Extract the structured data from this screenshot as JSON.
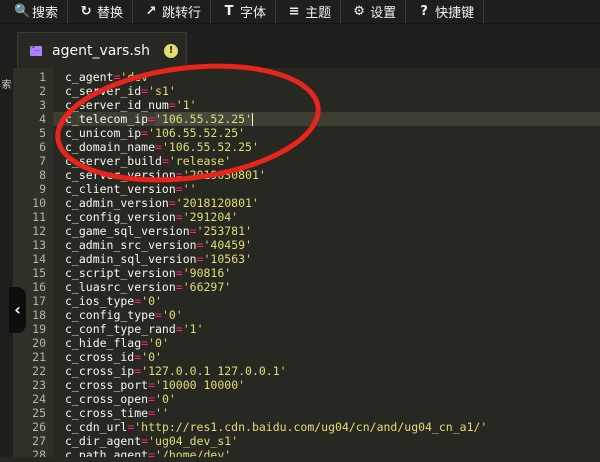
{
  "toolbar": {
    "buttons": [
      {
        "icon": "search-icon",
        "glyph": "🔍",
        "label": "搜索"
      },
      {
        "icon": "replace-icon",
        "glyph": "↻",
        "label": "替换"
      },
      {
        "icon": "goto-line-icon",
        "glyph": "↗",
        "label": "跳转行"
      },
      {
        "icon": "font-icon",
        "glyph": "T",
        "label": "字体"
      },
      {
        "icon": "theme-icon",
        "glyph": "≡",
        "label": "主题"
      },
      {
        "icon": "gear-icon",
        "glyph": "⚙",
        "label": "设置"
      },
      {
        "icon": "help-icon",
        "glyph": "?",
        "label": "快捷键"
      }
    ]
  },
  "tab": {
    "title": "agent_vars.sh",
    "unsaved_glyph": "!"
  },
  "sidebar": {
    "label": "索"
  },
  "collapse_glyph": "‹",
  "editor": {
    "active_line": 4,
    "lines": [
      {
        "n": "1",
        "name": "c_agent",
        "value": "'dev'"
      },
      {
        "n": "2",
        "name": "c_server_id",
        "value": "'s1'"
      },
      {
        "n": "3",
        "name": "c_server_id_num",
        "value": "'1'"
      },
      {
        "n": "4",
        "name": "c_telecom_ip",
        "value": "'106.55.52.25'"
      },
      {
        "n": "5",
        "name": "c_unicom_ip",
        "value": "'106.55.52.25'"
      },
      {
        "n": "6",
        "name": "c_domain_name",
        "value": "'106.55.52.25'"
      },
      {
        "n": "7",
        "name": "c_server_build",
        "value": "'release'"
      },
      {
        "n": "8",
        "name": "c_server_version",
        "value": "'2019030801'"
      },
      {
        "n": "9",
        "name": "c_client_version",
        "value": "''"
      },
      {
        "n": "10",
        "name": "c_admin_version",
        "value": "'2018120801'"
      },
      {
        "n": "11",
        "name": "c_config_version",
        "value": "'291204'"
      },
      {
        "n": "12",
        "name": "c_game_sql_version",
        "value": "'253781'"
      },
      {
        "n": "13",
        "name": "c_admin_src_version",
        "value": "'40459'"
      },
      {
        "n": "14",
        "name": "c_admin_sql_version",
        "value": "'10563'"
      },
      {
        "n": "15",
        "name": "c_script_version",
        "value": "'90816'"
      },
      {
        "n": "16",
        "name": "c_luasrc_version",
        "value": "'66297'"
      },
      {
        "n": "17",
        "name": "c_ios_type",
        "value": "'0'"
      },
      {
        "n": "18",
        "name": "c_config_type",
        "value": "'0'"
      },
      {
        "n": "19",
        "name": "c_conf_type_rand",
        "value": "'1'"
      },
      {
        "n": "20",
        "name": "c_hide_flag",
        "value": "'0'"
      },
      {
        "n": "21",
        "name": "c_cross_id",
        "value": "'0'"
      },
      {
        "n": "22",
        "name": "c_cross_ip",
        "value": "'127.0.0.1 127.0.0.1'"
      },
      {
        "n": "23",
        "name": "c_cross_port",
        "value": "'10000 10000'"
      },
      {
        "n": "24",
        "name": "c_cross_open",
        "value": "'0'"
      },
      {
        "n": "25",
        "name": "c_cross_time",
        "value": "''"
      },
      {
        "n": "26",
        "name": "c_cdn_url",
        "value": "'http://res1.cdn.baidu.com/ug04/cn/and/ug04_cn_a1/'"
      },
      {
        "n": "27",
        "name": "c_dir_agent",
        "value": "'ug04_dev_s1'"
      },
      {
        "n": "28",
        "name": "c_path_agent",
        "value": "'/home/dev'"
      }
    ]
  },
  "colors": {
    "background": "#272822",
    "toolbar": "#1e1f1c",
    "keyword": "#f92672",
    "string": "#e6db74",
    "annotation_circle": "#e8241c"
  }
}
